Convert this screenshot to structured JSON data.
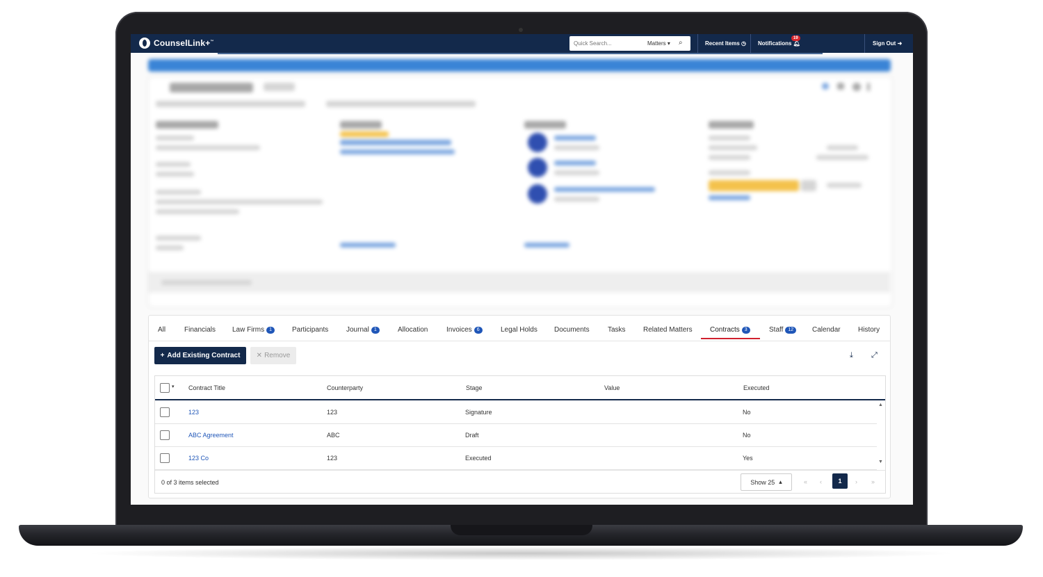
{
  "app": {
    "brand": "CounselLink+",
    "brand_sup": "™"
  },
  "topbar": {
    "search_placeholder": "Quick Search...",
    "search_scope": "Matters",
    "recent_items": "Recent Items",
    "notifications": "Notifications",
    "notifications_count": "19",
    "sign_out": "Sign Out"
  },
  "tabs": [
    {
      "label": "All"
    },
    {
      "label": "Financials"
    },
    {
      "label": "Law Firms",
      "badge": "1"
    },
    {
      "label": "Participants"
    },
    {
      "label": "Journal",
      "badge": "1"
    },
    {
      "label": "Allocation"
    },
    {
      "label": "Invoices",
      "badge": "6"
    },
    {
      "label": "Legal Holds"
    },
    {
      "label": "Documents"
    },
    {
      "label": "Tasks"
    },
    {
      "label": "Related Matters"
    },
    {
      "label": "Contracts",
      "badge": "3",
      "active": true
    },
    {
      "label": "Staff",
      "badge": "12"
    },
    {
      "label": "Calendar"
    },
    {
      "label": "History"
    }
  ],
  "toolbar": {
    "add_label": "Add Existing Contract",
    "remove_label": "Remove"
  },
  "table": {
    "columns": [
      "Contract Title",
      "Counterparty",
      "Stage",
      "Value",
      "Executed"
    ],
    "rows": [
      {
        "title": "123",
        "counterparty": "123",
        "stage": "Signature",
        "value": "",
        "executed": "No"
      },
      {
        "title": "ABC Agreement",
        "counterparty": "ABC",
        "stage": "Draft",
        "value": "",
        "executed": "No"
      },
      {
        "title": "123 Co",
        "counterparty": "123",
        "stage": "Executed",
        "value": "",
        "executed": "Yes"
      }
    ],
    "selection_text": "0 of 3 items selected",
    "page_size_label": "Show 25",
    "current_page": "1"
  },
  "colors": {
    "navy": "#13294b",
    "accent_red": "#d0202e",
    "link_blue": "#1f56b8",
    "badge_blue": "#1f56b8"
  }
}
